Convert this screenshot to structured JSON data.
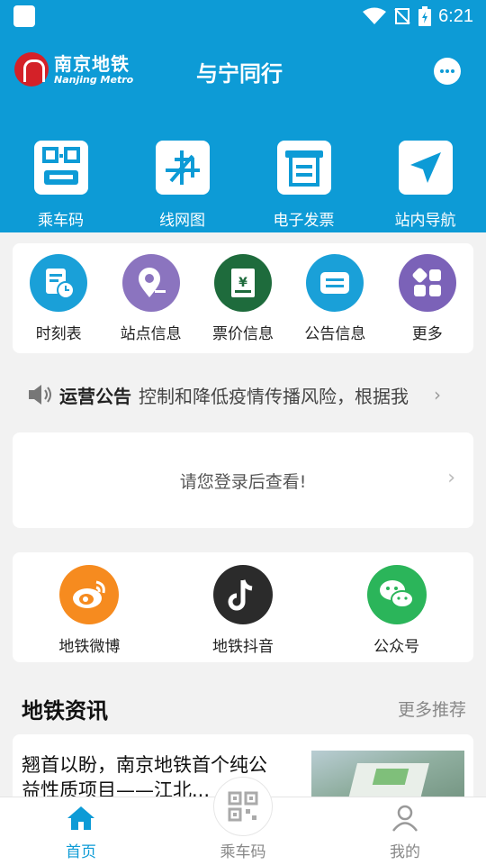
{
  "status_bar": {
    "time": "6:21"
  },
  "header": {
    "logo_cn": "南京地铁",
    "logo_en": "Nanjing Metro",
    "slogan": "与宁同行"
  },
  "top_nav": [
    {
      "label": "乘车码",
      "icon": "qr-ticket-icon"
    },
    {
      "label": "线网图",
      "icon": "network-map-icon"
    },
    {
      "label": "电子发票",
      "icon": "e-invoice-icon"
    },
    {
      "label": "站内导航",
      "icon": "navigation-icon"
    }
  ],
  "quick_menu": [
    {
      "label": "时刻表",
      "icon": "timetable-icon",
      "color": "#1aa0d8"
    },
    {
      "label": "站点信息",
      "icon": "location-icon",
      "color": "#8b74bf"
    },
    {
      "label": "票价信息",
      "icon": "fare-icon",
      "color": "#1e6b3c"
    },
    {
      "label": "公告信息",
      "icon": "announcement-icon",
      "color": "#1aa0d8"
    },
    {
      "label": "更多",
      "icon": "more-grid-icon",
      "color": "#7b62b8"
    }
  ],
  "notice": {
    "title": "运营公告",
    "text": "控制和降低疫情传播风险，根据我"
  },
  "login_prompt": "请您登录后查看!",
  "social": [
    {
      "label": "地铁微博",
      "icon": "weibo-icon",
      "color": "#f68b1f"
    },
    {
      "label": "地铁抖音",
      "icon": "douyin-icon",
      "color": "#2b2b2b"
    },
    {
      "label": "公众号",
      "icon": "wechat-icon",
      "color": "#2bb55a"
    }
  ],
  "news": {
    "title": "地铁资讯",
    "more": "更多推荐",
    "items": [
      {
        "title": "翘首以盼，南京地铁首个纯公益性质项目——江北..."
      }
    ]
  },
  "tabbar": [
    {
      "label": "首页",
      "active": true
    },
    {
      "label": "乘车码",
      "active": false
    },
    {
      "label": "我的",
      "active": false
    }
  ],
  "colors": {
    "brand": "#0d9bd6",
    "logo_red": "#d42128"
  }
}
